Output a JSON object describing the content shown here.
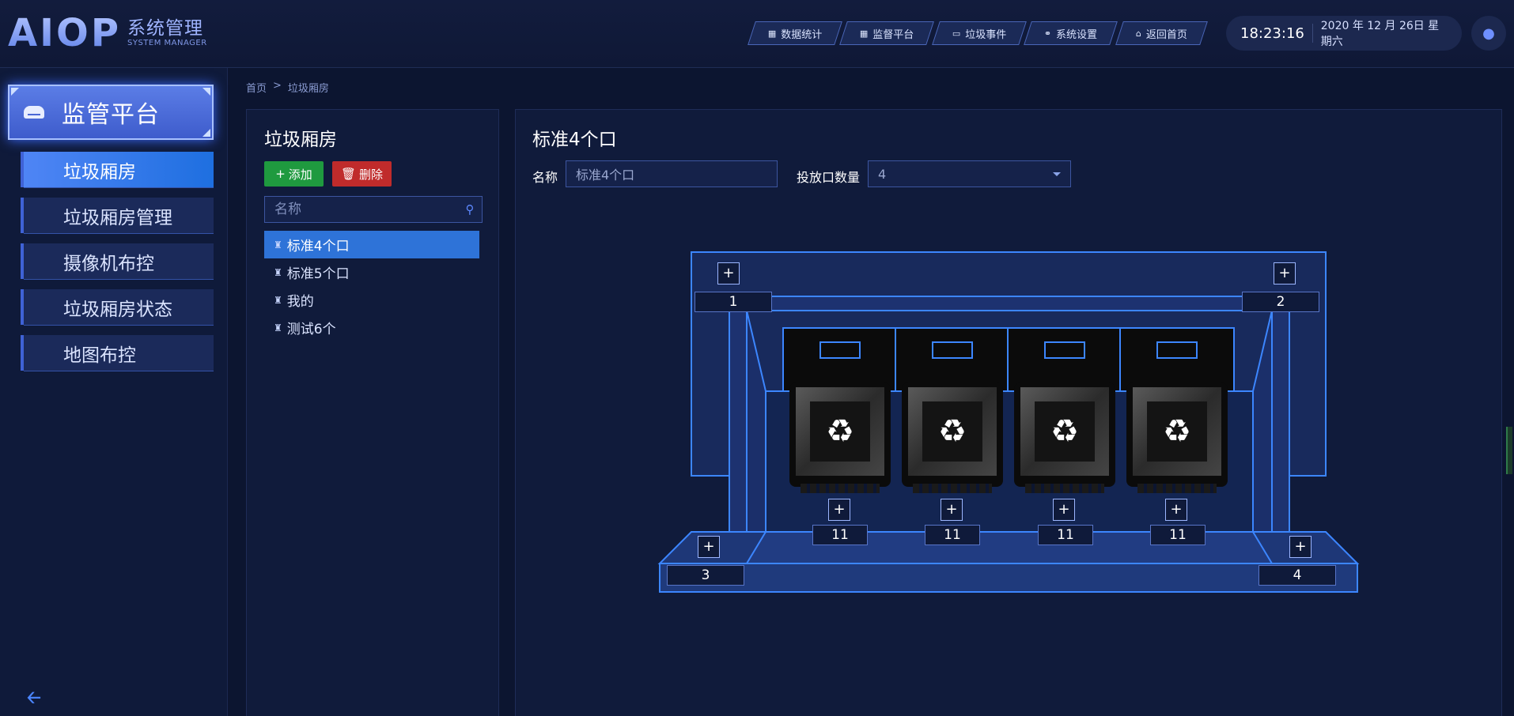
{
  "header": {
    "logo_main": "AIOP",
    "logo_cn": "系统管理",
    "logo_en": "SYSTEM MANAGER",
    "nav": [
      {
        "label": "数据统计",
        "icon": "grid-icon"
      },
      {
        "label": "监督平台",
        "icon": "grid-icon"
      },
      {
        "label": "垃圾事件",
        "icon": "monitor-icon"
      },
      {
        "label": "系统设置",
        "icon": "share-icon"
      },
      {
        "label": "返回首页",
        "icon": "home-icon"
      }
    ],
    "time": "18:23:16",
    "date": "2020 年 12 月 26日 星期六"
  },
  "sidebar": {
    "title": "监管平台",
    "items": [
      {
        "label": "垃圾厢房",
        "active": true
      },
      {
        "label": "垃圾厢房管理",
        "active": false
      },
      {
        "label": "摄像机布控",
        "active": false
      },
      {
        "label": "垃圾厢房状态",
        "active": false
      },
      {
        "label": "地图布控",
        "active": false
      }
    ]
  },
  "breadcrumb": {
    "home": "首页",
    "sep": ">",
    "current": "垃圾厢房"
  },
  "left_panel": {
    "title": "垃圾厢房",
    "add_label": "添加",
    "delete_label": "删除",
    "search_placeholder": "名称",
    "list": [
      {
        "label": "标准4个口",
        "active": true
      },
      {
        "label": "标准5个口",
        "active": false
      },
      {
        "label": "我的",
        "active": false
      },
      {
        "label": "测试6个",
        "active": false
      }
    ]
  },
  "right_panel": {
    "title": "标准4个口",
    "name_label": "名称",
    "name_value": "标准4个口",
    "count_label": "投放口数量",
    "count_value": "4",
    "cameras": [
      "1",
      "2",
      "3",
      "4"
    ],
    "bins": [
      "11",
      "11",
      "11",
      "11"
    ],
    "plus": "+"
  },
  "colors": {
    "accent": "#2e73d8",
    "add": "#1f9a3f",
    "delete": "#c02b2b",
    "outline": "#3c86ff"
  }
}
